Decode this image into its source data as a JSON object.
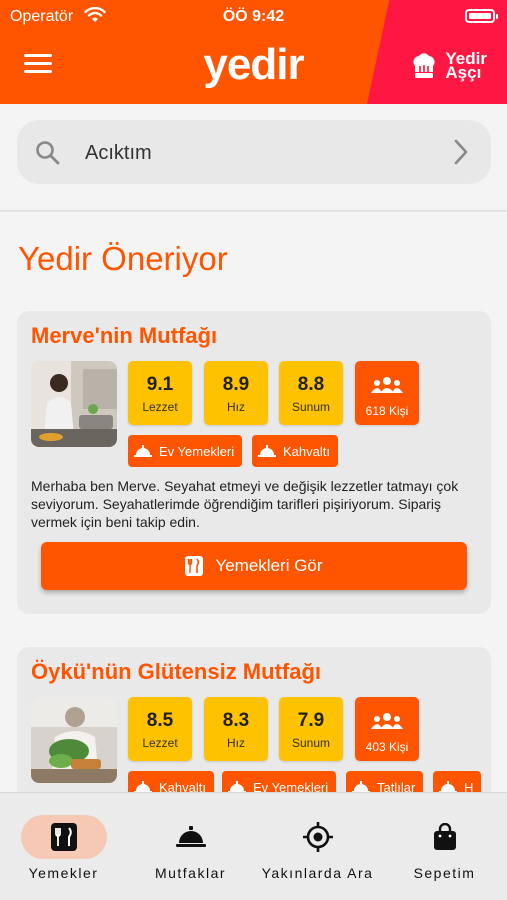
{
  "status_bar": {
    "carrier": "Operatör",
    "time": "ÖÖ 9:42"
  },
  "header": {
    "logo": "yedir",
    "partner_logo_line1": "Yedir",
    "partner_logo_line2": "Aşçı"
  },
  "search": {
    "text": "Acıktım"
  },
  "section_title": "Yedir Öneriyor",
  "cards": [
    {
      "title": "Merve'nin Mutfağı",
      "scores": [
        {
          "value": "9.1",
          "label": "Lezzet"
        },
        {
          "value": "8.9",
          "label": "Hız"
        },
        {
          "value": "8.8",
          "label": "Sunum"
        }
      ],
      "people": "618 Kişi",
      "tags": [
        "Ev Yemekleri",
        "Kahvaltı"
      ],
      "description": "Merhaba ben Merve. Seyahat etmeyi ve değişik lezzetler tatmayı çok seviyorum. Seyahatlerimde öğrendiğim tarifleri pişiriyorum. Sipariş vermek için beni takip edin.",
      "button": "Yemekleri Gör"
    },
    {
      "title": "Öykü'nün Glütensiz Mutfağı",
      "scores": [
        {
          "value": "8.5",
          "label": "Lezzet"
        },
        {
          "value": "8.3",
          "label": "Hız"
        },
        {
          "value": "7.9",
          "label": "Sunum"
        }
      ],
      "people": "403 Kişi",
      "tags": [
        "Kahvaltı",
        "Ev Yemekleri",
        "Tatlılar",
        "H"
      ]
    }
  ],
  "tabs": [
    {
      "label": "Yemekler",
      "icon": "utensils-icon",
      "active": true
    },
    {
      "label": "Mutfaklar",
      "icon": "cloche-icon",
      "active": false
    },
    {
      "label": "Yakınlarda Ara",
      "icon": "target-icon",
      "active": false
    },
    {
      "label": "Sepetim",
      "icon": "bag-icon",
      "active": false
    }
  ],
  "colors": {
    "primary": "#ff5400",
    "accent_red": "#ff1744",
    "score_yellow": "#ffc200"
  }
}
